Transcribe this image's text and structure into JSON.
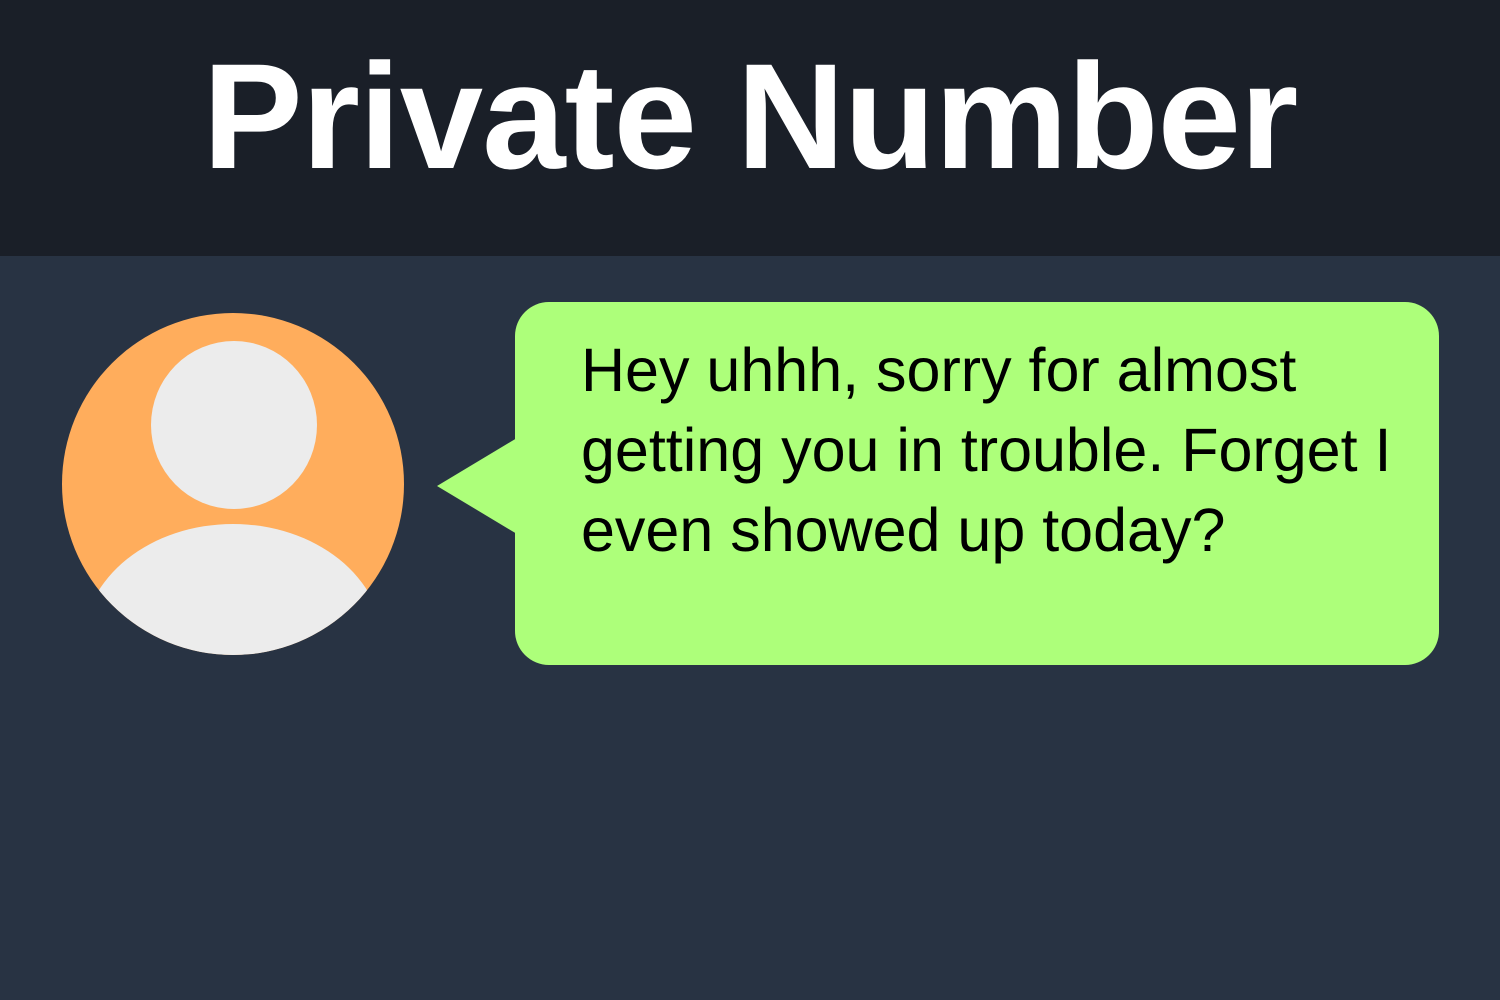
{
  "header": {
    "title": "Private Number"
  },
  "contact": {
    "avatar_icon": "person-silhouette-icon",
    "avatar_color": "#ffad5c",
    "silhouette_color": "#ececec"
  },
  "message": {
    "text": "Hey uhhh, sorry for almost getting you in trouble. Forget I even showed up today?",
    "bubble_color": "#adff7a"
  },
  "colors": {
    "header_background": "#1a1f28",
    "chat_background": "#283343",
    "title_text": "#ffffff",
    "message_text": "#000000"
  }
}
